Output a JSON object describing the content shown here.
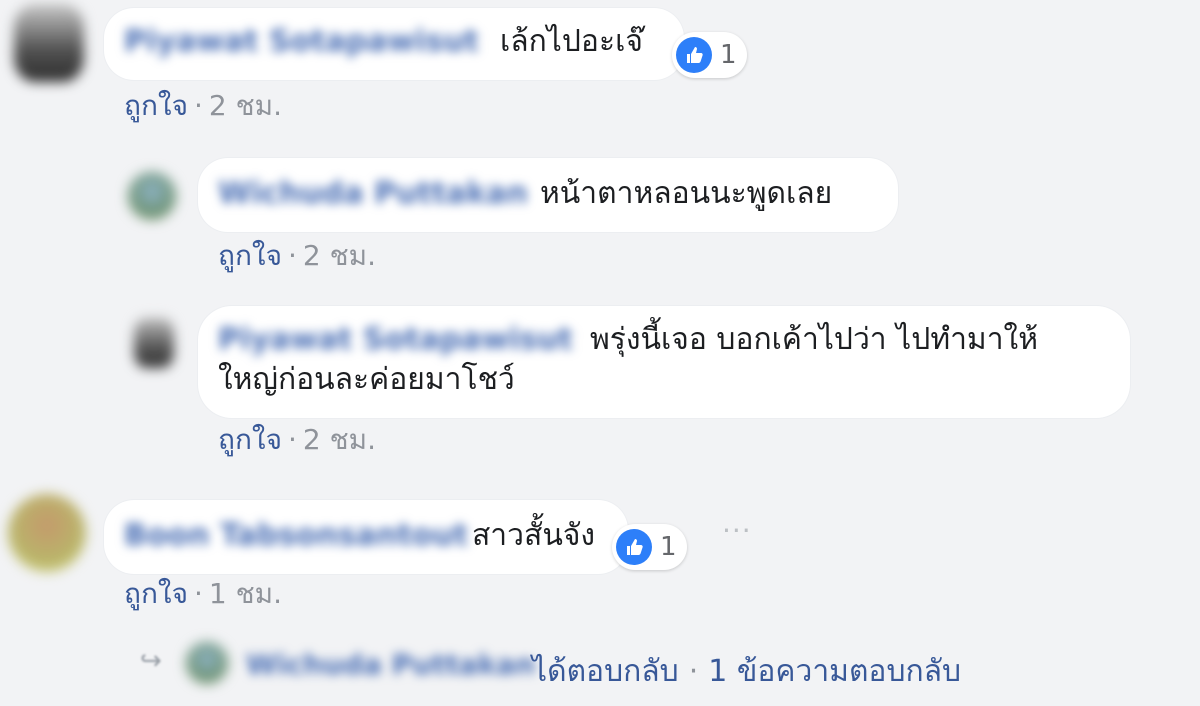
{
  "comments": [
    {
      "author": "Piyawat Sotapawisut",
      "text": "เล้กไปอะเจ๊",
      "reaction_count": "1",
      "like_label": "ถูกใจ",
      "separator": "·",
      "time": "2 ชม."
    },
    {
      "author": "Wichuda Puttakan",
      "text": "หน้าตาหลอนนะพูดเลย",
      "like_label": "ถูกใจ",
      "separator": "·",
      "time": "2 ชม."
    },
    {
      "author": "Piyawat Sotapawisut",
      "text_line1": "พรุ่งนี้เจอ บอกเค้าไปว่า ไปทำมาให้",
      "text_line2": "ใหญ่ก่อนละค่อยมาโชว์",
      "like_label": "ถูกใจ",
      "separator": "·",
      "time": "2 ชม."
    },
    {
      "author": "Boon Tabsonsantout",
      "text": "สาวสั้นจัง",
      "reaction_count": "1",
      "like_label": "ถูกใจ",
      "separator": "·",
      "time": "1 ชม."
    }
  ],
  "reply_summary": {
    "author": "Wichuda Puttakan",
    "action": "ได้ตอบกลับ",
    "separator": "·",
    "count_label": "1 ข้อความตอบกลับ"
  },
  "icons": {
    "like": "thumbs-up-icon",
    "more": "more-options-icon",
    "reply": "reply-arrow-icon"
  },
  "colors": {
    "background": "#f2f3f5",
    "link": "#385898",
    "like_badge": "#2d7ff9"
  }
}
